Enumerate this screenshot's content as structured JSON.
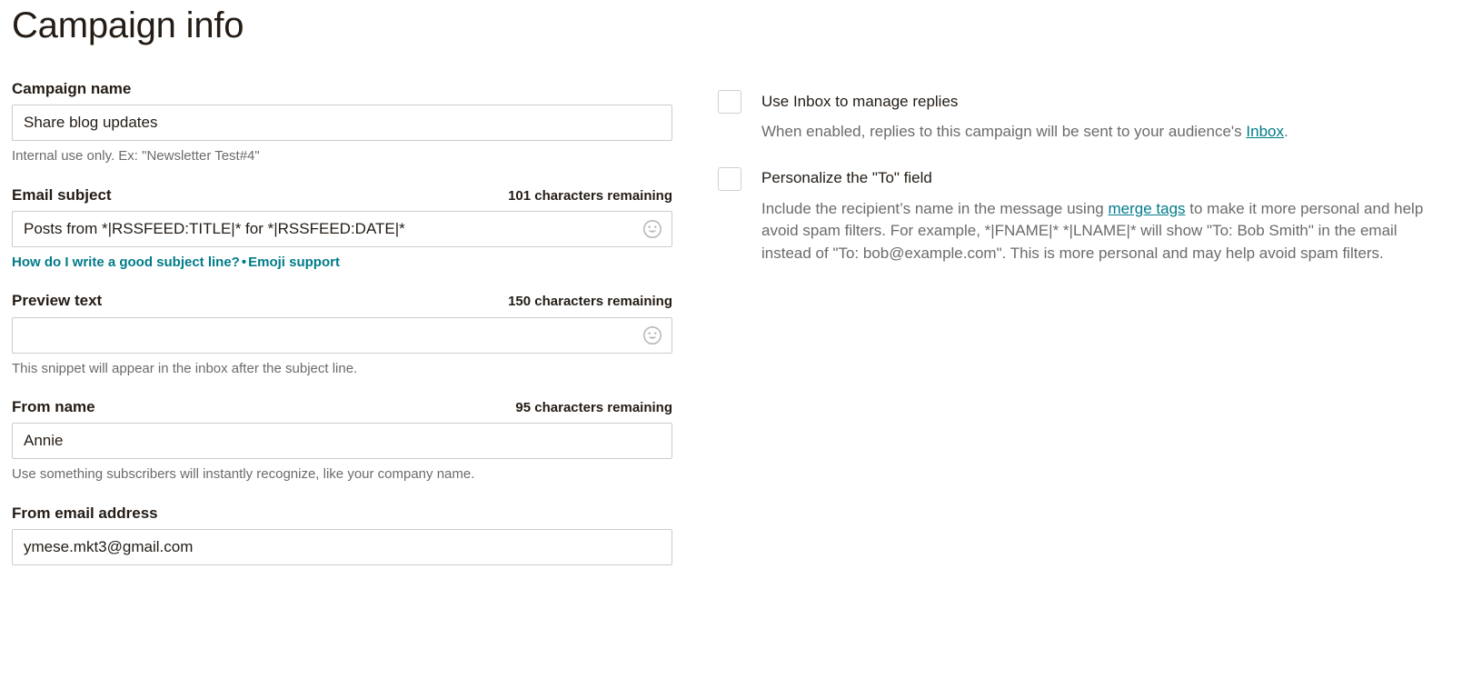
{
  "page": {
    "title": "Campaign info"
  },
  "form": {
    "campaign_name": {
      "label": "Campaign name",
      "value": "Share blog updates",
      "placeholder": "",
      "help": "Internal use only. Ex: \"Newsletter Test#4\""
    },
    "email_subject": {
      "label": "Email subject",
      "char_count": "101 characters remaining",
      "value": "Posts from *|RSSFEED:TITLE|* for *|RSSFEED:DATE|*",
      "placeholder": "",
      "emoji_icon": "smiley-face-icon",
      "link_primary": "How do I write a good subject line?",
      "separator": "•",
      "link_secondary": "Emoji support"
    },
    "preview_text": {
      "label": "Preview text",
      "char_count": "150 characters remaining",
      "value": "",
      "placeholder": "",
      "emoji_icon": "smiley-face-icon",
      "help": "This snippet will appear in the inbox after the subject line."
    },
    "from_name": {
      "label": "From name",
      "char_count": "95 characters remaining",
      "value": "Annie",
      "placeholder": "",
      "help": "Use something subscribers will instantly recognize, like your company name."
    },
    "from_email": {
      "label": "From email address",
      "value": "ymese.mkt3@gmail.com",
      "placeholder": ""
    }
  },
  "options": {
    "use_inbox": {
      "label": "Use Inbox to manage replies",
      "checked": false,
      "desc_before": "When enabled, replies to this campaign will be sent to your audience's ",
      "desc_link": "Inbox",
      "desc_after": "."
    },
    "personalize_to": {
      "label": "Personalize the \"To\" field",
      "checked": false,
      "desc_before": "Include the recipient’s name in the message using ",
      "desc_link": "merge tags",
      "desc_after": " to make it more personal and help avoid spam filters. For example, *|FNAME|* *|LNAME|* will show \"To: Bob Smith\" in the email instead of \"To: bob@example.com\". This is more personal and may help avoid spam filters."
    }
  },
  "colors": {
    "link": "#007c89",
    "text": "#241c15",
    "muted": "#6b6b6b",
    "border": "#cccccc"
  }
}
